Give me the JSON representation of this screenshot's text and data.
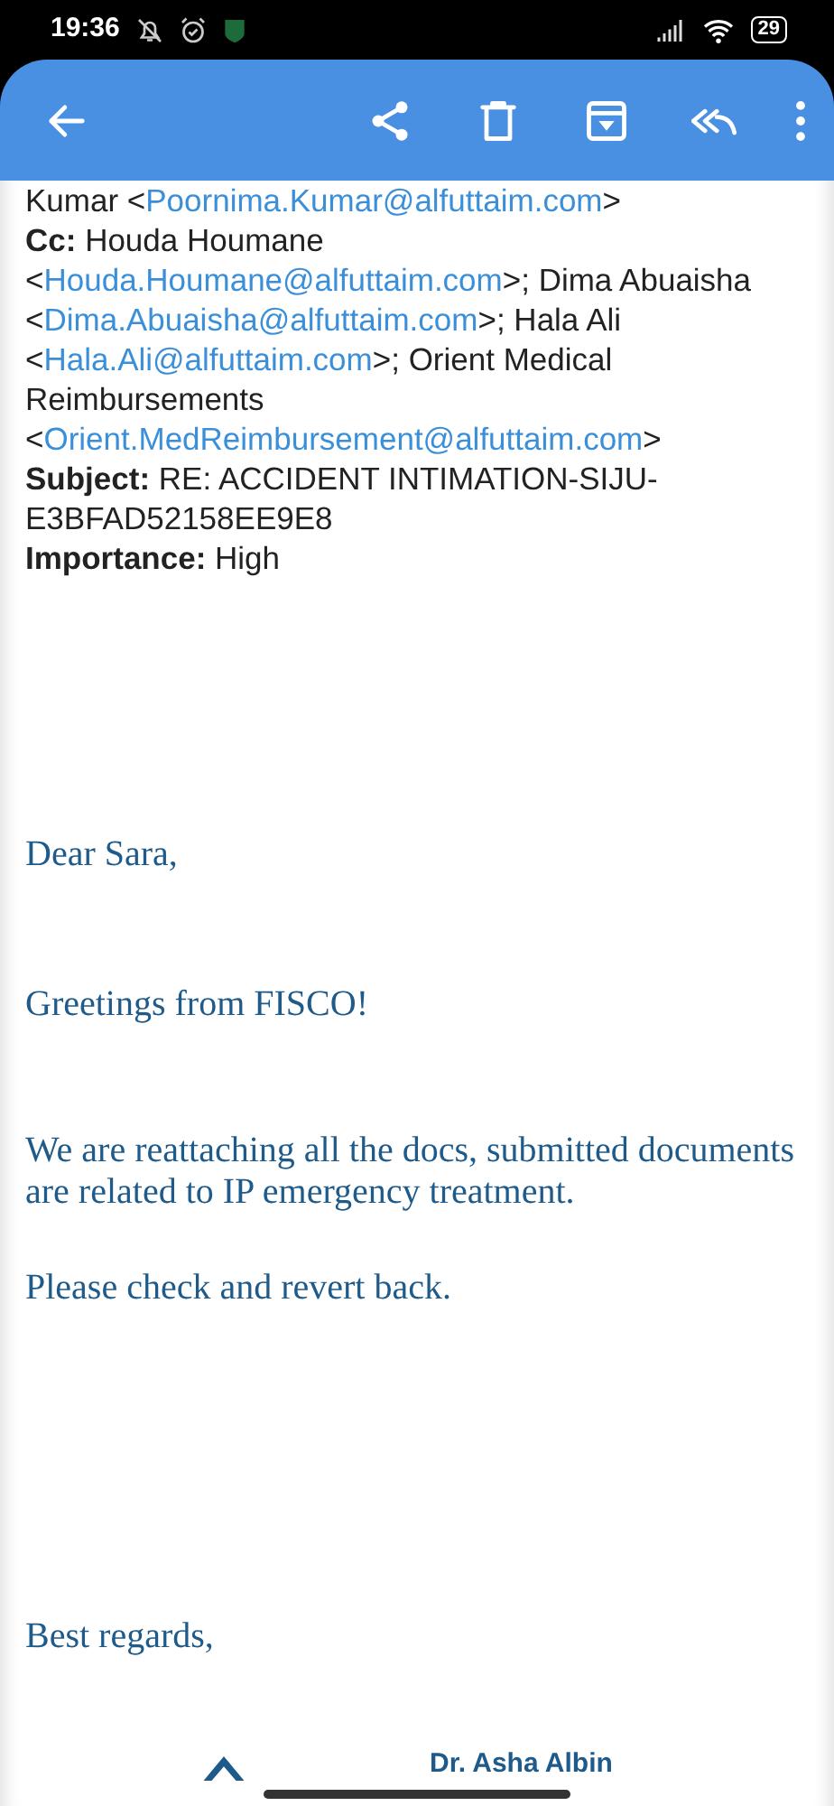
{
  "status_bar": {
    "time": "19:36",
    "battery": "29"
  },
  "header": [
    {
      "parts": [
        {
          "kind": "text",
          "text": "Kumar <"
        },
        {
          "kind": "link",
          "text": "Poornima.Kumar@alfuttaim.com"
        },
        {
          "kind": "text",
          "text": ">"
        }
      ]
    },
    {
      "parts": [
        {
          "kind": "label",
          "text": "Cc:"
        },
        {
          "kind": "text",
          "text": " Houda Houmane <"
        },
        {
          "kind": "link",
          "text": "Houda.Houmane@alfuttaim.com"
        },
        {
          "kind": "text",
          "text": ">; Dima Abuaisha <"
        },
        {
          "kind": "link",
          "text": "Dima.Abuaisha@alfuttaim.com"
        },
        {
          "kind": "text",
          "text": ">; Hala Ali <"
        },
        {
          "kind": "link",
          "text": "Hala.Ali@alfuttaim.com"
        },
        {
          "kind": "text",
          "text": ">; Orient Medical Reimbursements <"
        },
        {
          "kind": "link",
          "text": "Orient.MedReimbursement@alfuttaim.com"
        },
        {
          "kind": "text",
          "text": ">"
        }
      ]
    },
    {
      "parts": [
        {
          "kind": "label",
          "text": "Subject:"
        },
        {
          "kind": "text",
          "text": " RE: ACCIDENT INTIMATION-SIJU-E3BFAD52158EE9E8"
        }
      ]
    },
    {
      "parts": [
        {
          "kind": "label",
          "text": "Importance:"
        },
        {
          "kind": "text",
          "text": " High"
        }
      ]
    }
  ],
  "body": [
    "Dear Sara,",
    "Greetings from FISCO!",
    "We are reattaching all the docs, submitted documents are related to IP emergency treatment.",
    "Please check and revert back.",
    "Best regards,"
  ],
  "signature": {
    "name": "Dr. Asha Albin"
  }
}
